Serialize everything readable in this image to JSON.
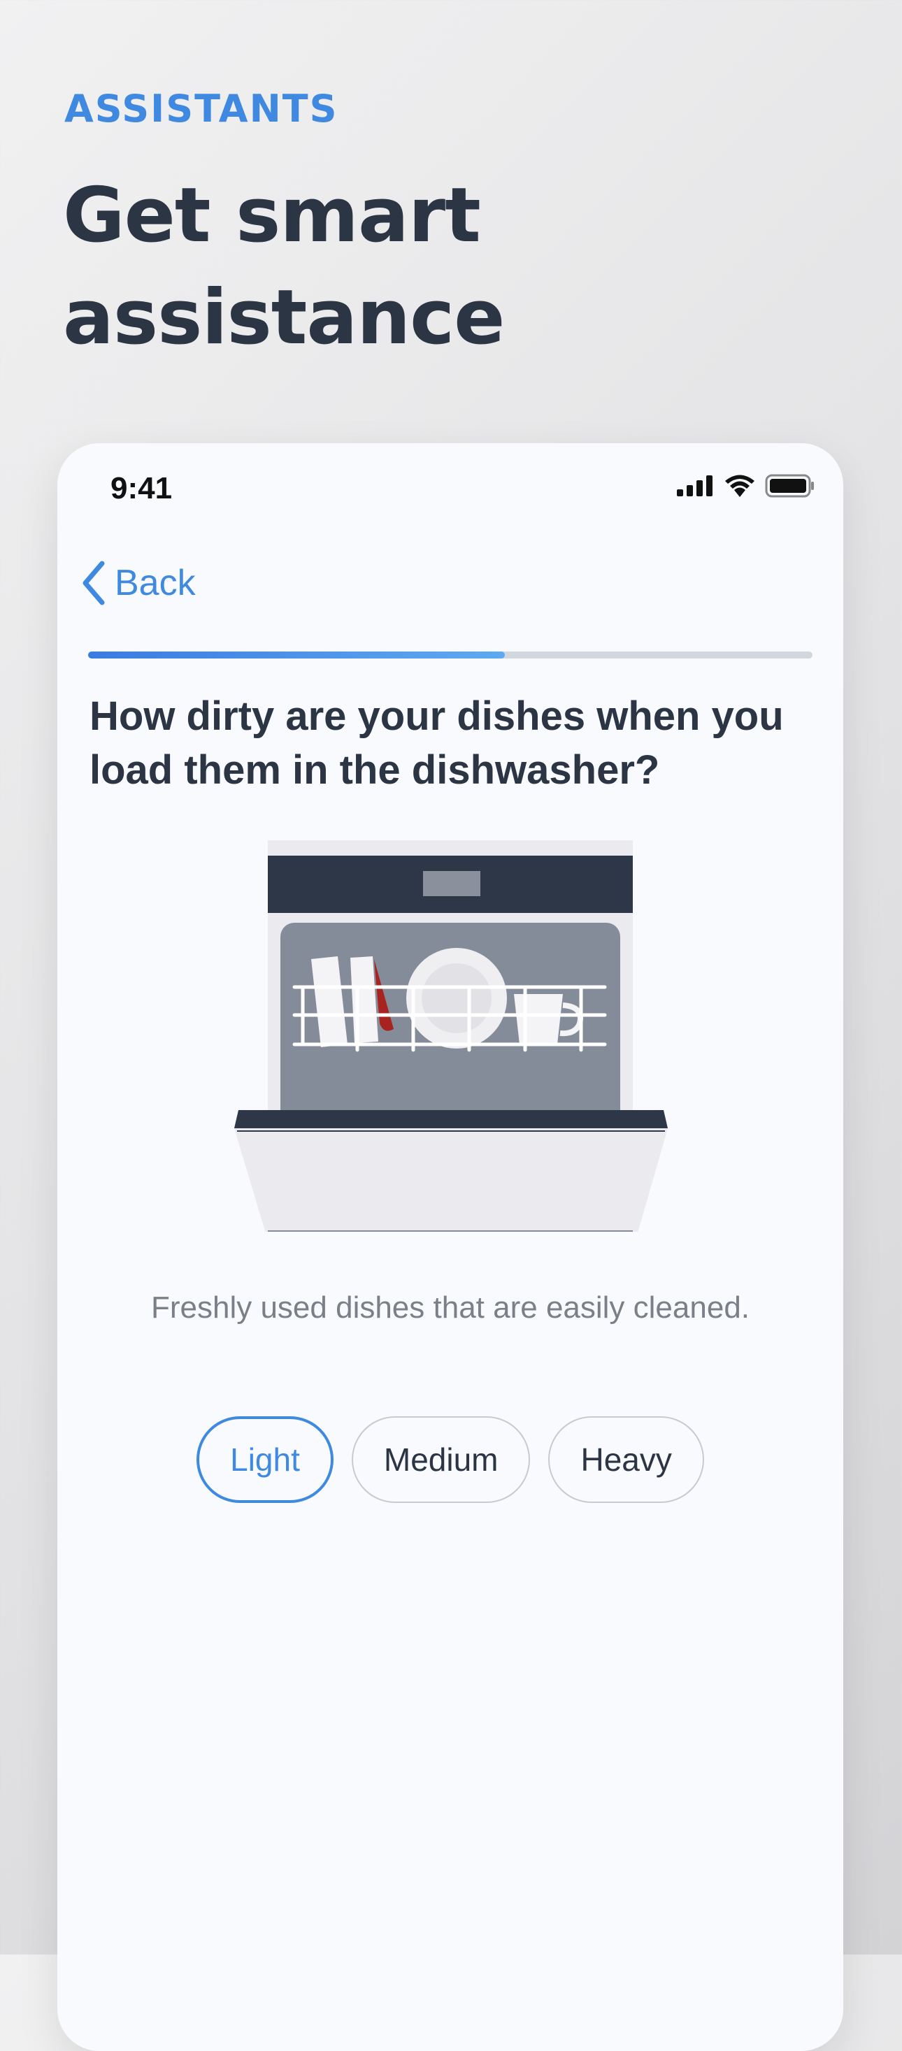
{
  "header": {
    "eyebrow": "ASSISTANTS",
    "headline": "Get smart assistance"
  },
  "status_bar": {
    "time": "9:41",
    "icons": [
      "signal-icon",
      "wifi-icon",
      "battery-icon"
    ]
  },
  "nav": {
    "back_label": "Back"
  },
  "progress": {
    "fraction": 0.575
  },
  "question": "How dirty are your dishes when you load them in the dishwasher?",
  "illustration": {
    "subject": "dishwasher with loaded rack"
  },
  "caption": "Freshly used dishes that are easily cleaned.",
  "choices": [
    {
      "label": "Light",
      "selected": true
    },
    {
      "label": "Medium",
      "selected": false
    },
    {
      "label": "Heavy",
      "selected": false
    }
  ],
  "colors": {
    "accent": "#3f8ae0",
    "heading": "#2b3544",
    "caption": "#7b8088",
    "dishwasher_dark": "#2d3747",
    "dishwasher_interior": "#858c99",
    "stain": "#a8231f"
  }
}
